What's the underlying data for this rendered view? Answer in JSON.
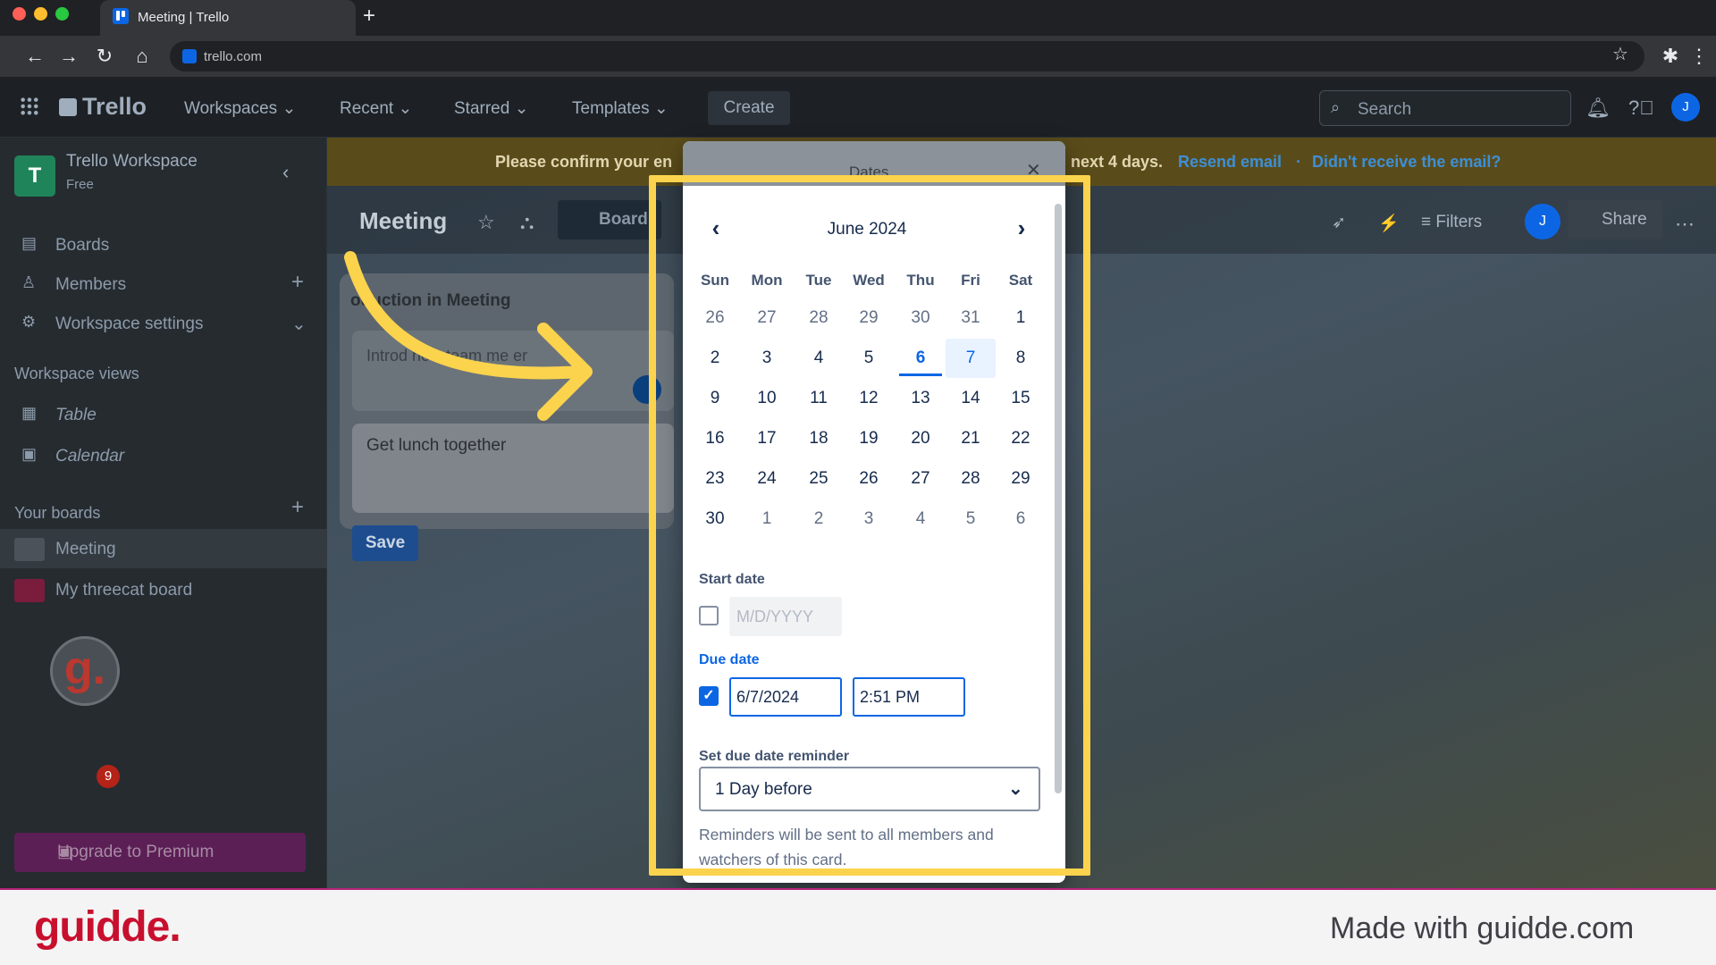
{
  "browser": {
    "tab_title": "Meeting | Trello",
    "new_tab": "+",
    "url": "trello.com"
  },
  "header": {
    "logo": "Trello",
    "menus": [
      "Workspaces",
      "Recent",
      "Starred",
      "Templates"
    ],
    "create": "Create",
    "search_placeholder": "Search",
    "avatar": "J"
  },
  "banner": {
    "left_text": "Please confirm your en",
    "right_text": "next 4 days.",
    "resend": "Resend email",
    "sep": "·",
    "no_email": "Didn't receive the email?"
  },
  "sidebar": {
    "workspace_initial": "T",
    "workspace_name": "Trello Workspace",
    "plan": "Free",
    "items": [
      "Boards",
      "Members",
      "Workspace settings"
    ],
    "views_heading": "Workspace views",
    "views": [
      "Table",
      "Calendar"
    ],
    "boards_heading": "Your boards",
    "boards": [
      {
        "name": "Meeting",
        "color": "#4b5259"
      },
      {
        "name": "My threecat board",
        "color": "#7a1d3d"
      }
    ],
    "upgrade": "Upgrade to Premium",
    "guidde_letter": "g.",
    "guidde_count": "9"
  },
  "board": {
    "title": "Meeting",
    "view": "Board",
    "filters": "Filters",
    "share": "Share",
    "avatar": "J",
    "list_title": "oduction in Meeting",
    "card_text": "Introd      new team me     er",
    "edit_card_text": "Get lunch together",
    "save": "Save"
  },
  "dates": {
    "title": "Dates",
    "month": "June 2024",
    "dow": [
      "Sun",
      "Mon",
      "Tue",
      "Wed",
      "Thu",
      "Fri",
      "Sat"
    ],
    "weeks": [
      [
        "26",
        "27",
        "28",
        "29",
        "30",
        "31",
        "1"
      ],
      [
        "2",
        "3",
        "4",
        "5",
        "6",
        "7",
        "8"
      ],
      [
        "9",
        "10",
        "11",
        "12",
        "13",
        "14",
        "15"
      ],
      [
        "16",
        "17",
        "18",
        "19",
        "20",
        "21",
        "22"
      ],
      [
        "23",
        "24",
        "25",
        "26",
        "27",
        "28",
        "29"
      ],
      [
        "30",
        "1",
        "2",
        "3",
        "4",
        "5",
        "6"
      ]
    ],
    "today": "6",
    "selected": "7",
    "start_label": "Start date",
    "start_placeholder": "M/D/YYYY",
    "due_label": "Due date",
    "due_date": "6/7/2024",
    "due_time": "2:51 PM",
    "reminder_label": "Set due date reminder",
    "reminder_value": "1 Day before",
    "helper": "Reminders will be sent to all members and watchers of this card."
  },
  "footer": {
    "brand": "guidde.",
    "made_with": "Made with guidde.com"
  },
  "colors": {
    "accent": "#0c66e4",
    "highlight": "#fcd34d",
    "brand": "#c8102e"
  }
}
